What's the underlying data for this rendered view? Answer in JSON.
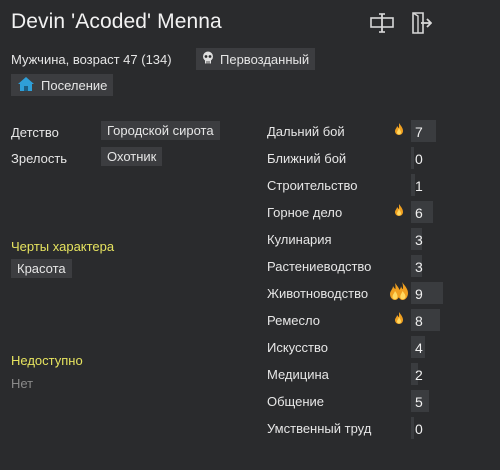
{
  "header": {
    "name": "Devin 'Acoded' Menna",
    "icons": [
      "rename-icon",
      "exit-icon"
    ]
  },
  "bio": {
    "summary": "Мужчина, возраст 47 (134)",
    "xenotype": "Первозданный",
    "faction": "Поселение"
  },
  "backstory": {
    "childhood_label": "Детство",
    "childhood_value": "Городской сирота",
    "adulthood_label": "Зрелость",
    "adulthood_value": "Охотник"
  },
  "traits": {
    "title": "Черты характера",
    "items": [
      "Красота"
    ]
  },
  "incapable": {
    "title": "Недоступно",
    "value": "Нет"
  },
  "skills": [
    {
      "name": "Дальний бой",
      "level": "7",
      "passion": 1,
      "fill": 0.35
    },
    {
      "name": "Ближний бой",
      "level": "0",
      "passion": 0,
      "fill": 0.0
    },
    {
      "name": "Строительство",
      "level": "1",
      "passion": 0,
      "fill": 0.05
    },
    {
      "name": "Горное дело",
      "level": "6",
      "passion": 1,
      "fill": 0.3
    },
    {
      "name": "Кулинария",
      "level": "3",
      "passion": 0,
      "fill": 0.15
    },
    {
      "name": "Растениеводство",
      "level": "3",
      "passion": 0,
      "fill": 0.15
    },
    {
      "name": "Животноводство",
      "level": "9",
      "passion": 2,
      "fill": 0.45
    },
    {
      "name": "Ремесло",
      "level": "8",
      "passion": 1,
      "fill": 0.4
    },
    {
      "name": "Искусство",
      "level": "4",
      "passion": 0,
      "fill": 0.2
    },
    {
      "name": "Медицина",
      "level": "2",
      "passion": 0,
      "fill": 0.1
    },
    {
      "name": "Общение",
      "level": "5",
      "passion": 0,
      "fill": 0.25
    },
    {
      "name": "Умственный труд",
      "level": "0",
      "passion": 0,
      "fill": 0.0
    }
  ],
  "colors": {
    "background": "#2a2b2d",
    "chip": "#3c3d40",
    "accent_yellow": "#e6e35f",
    "flame": "#f0a020",
    "home_icon": "#2f9fd8"
  }
}
